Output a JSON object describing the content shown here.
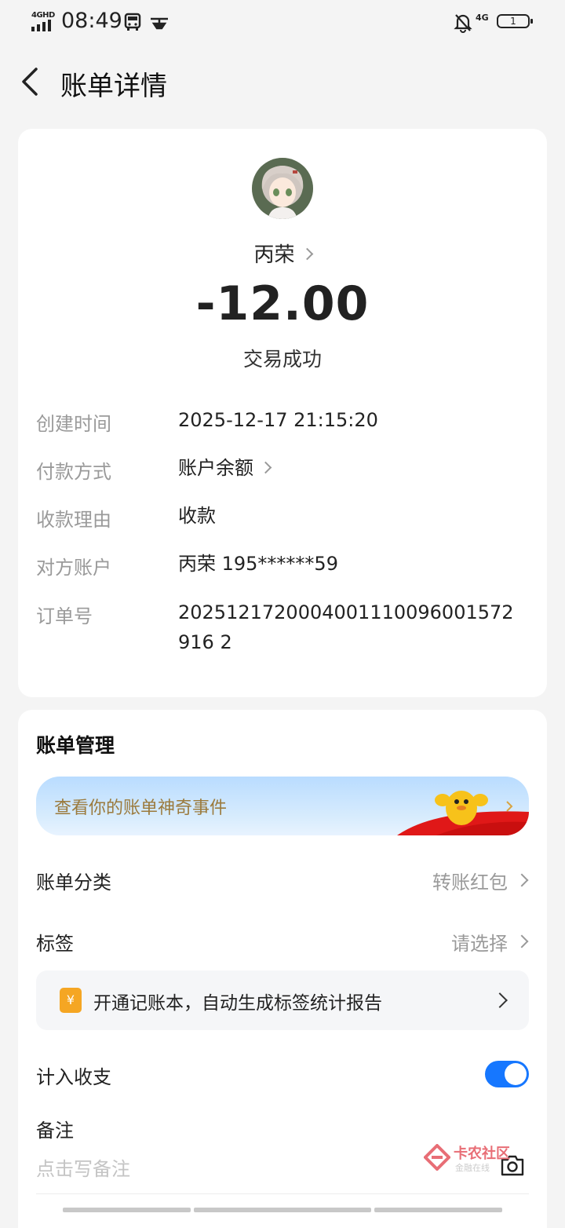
{
  "status_bar": {
    "network": "4GHD",
    "time": "08:49",
    "right_network": "4G",
    "battery": "1"
  },
  "header": {
    "title": "账单详情"
  },
  "transaction": {
    "payee": "丙荣",
    "amount": "-12.00",
    "status": "交易成功",
    "details": [
      {
        "label": "创建时间",
        "value": "2025-12-17 21:15:20"
      },
      {
        "label": "付款方式",
        "value": "账户余额"
      },
      {
        "label": "收款理由",
        "value": "收款"
      },
      {
        "label": "对方账户",
        "value": "丙荣 195******59"
      },
      {
        "label": "订单号",
        "value": "2025121720004001110096001572916 2"
      }
    ]
  },
  "management": {
    "title": "账单管理",
    "banner_text": "查看你的账单神奇事件",
    "category_label": "账单分类",
    "category_value": "转账红包",
    "tag_label": "标签",
    "tag_value": "请选择",
    "promo_icon": "¥",
    "promo_text": "开通记账本，自动生成标签统计报告",
    "include_label": "计入收支",
    "include_enabled": true,
    "note_label": "备注",
    "note_placeholder": "点击写备注"
  },
  "watermark": {
    "text": "卡农社区",
    "sub": "金融在线"
  },
  "colors": {
    "accent": "#1677ff",
    "banner_text": "#9b7a3c"
  }
}
